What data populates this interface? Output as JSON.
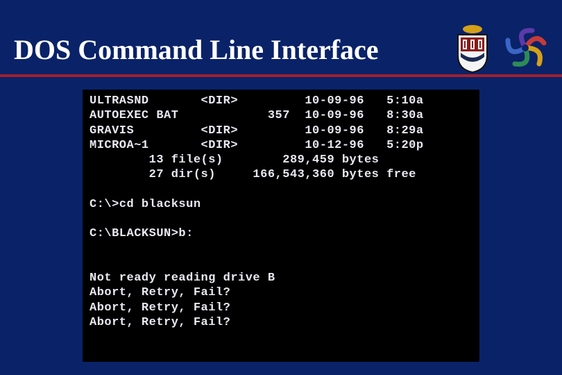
{
  "header": {
    "title": "DOS Command Line Interface"
  },
  "terminal": {
    "lines": [
      "ULTRASND       <DIR>         10-09-96   5:10a",
      "AUTOEXEC BAT            357  10-09-96   8:30a",
      "GRAVIS         <DIR>         10-09-96   8:29a",
      "MICROA~1       <DIR>         10-12-96   5:20p",
      "        13 file(s)        289,459 bytes",
      "        27 dir(s)     166,543,360 bytes free",
      "",
      "C:\\>cd blacksun",
      "",
      "C:\\BLACKSUN>b:",
      "",
      "",
      "Not ready reading drive B",
      "Abort, Retry, Fail?",
      "Abort, Retry, Fail?",
      "Abort, Retry, Fail?"
    ]
  }
}
